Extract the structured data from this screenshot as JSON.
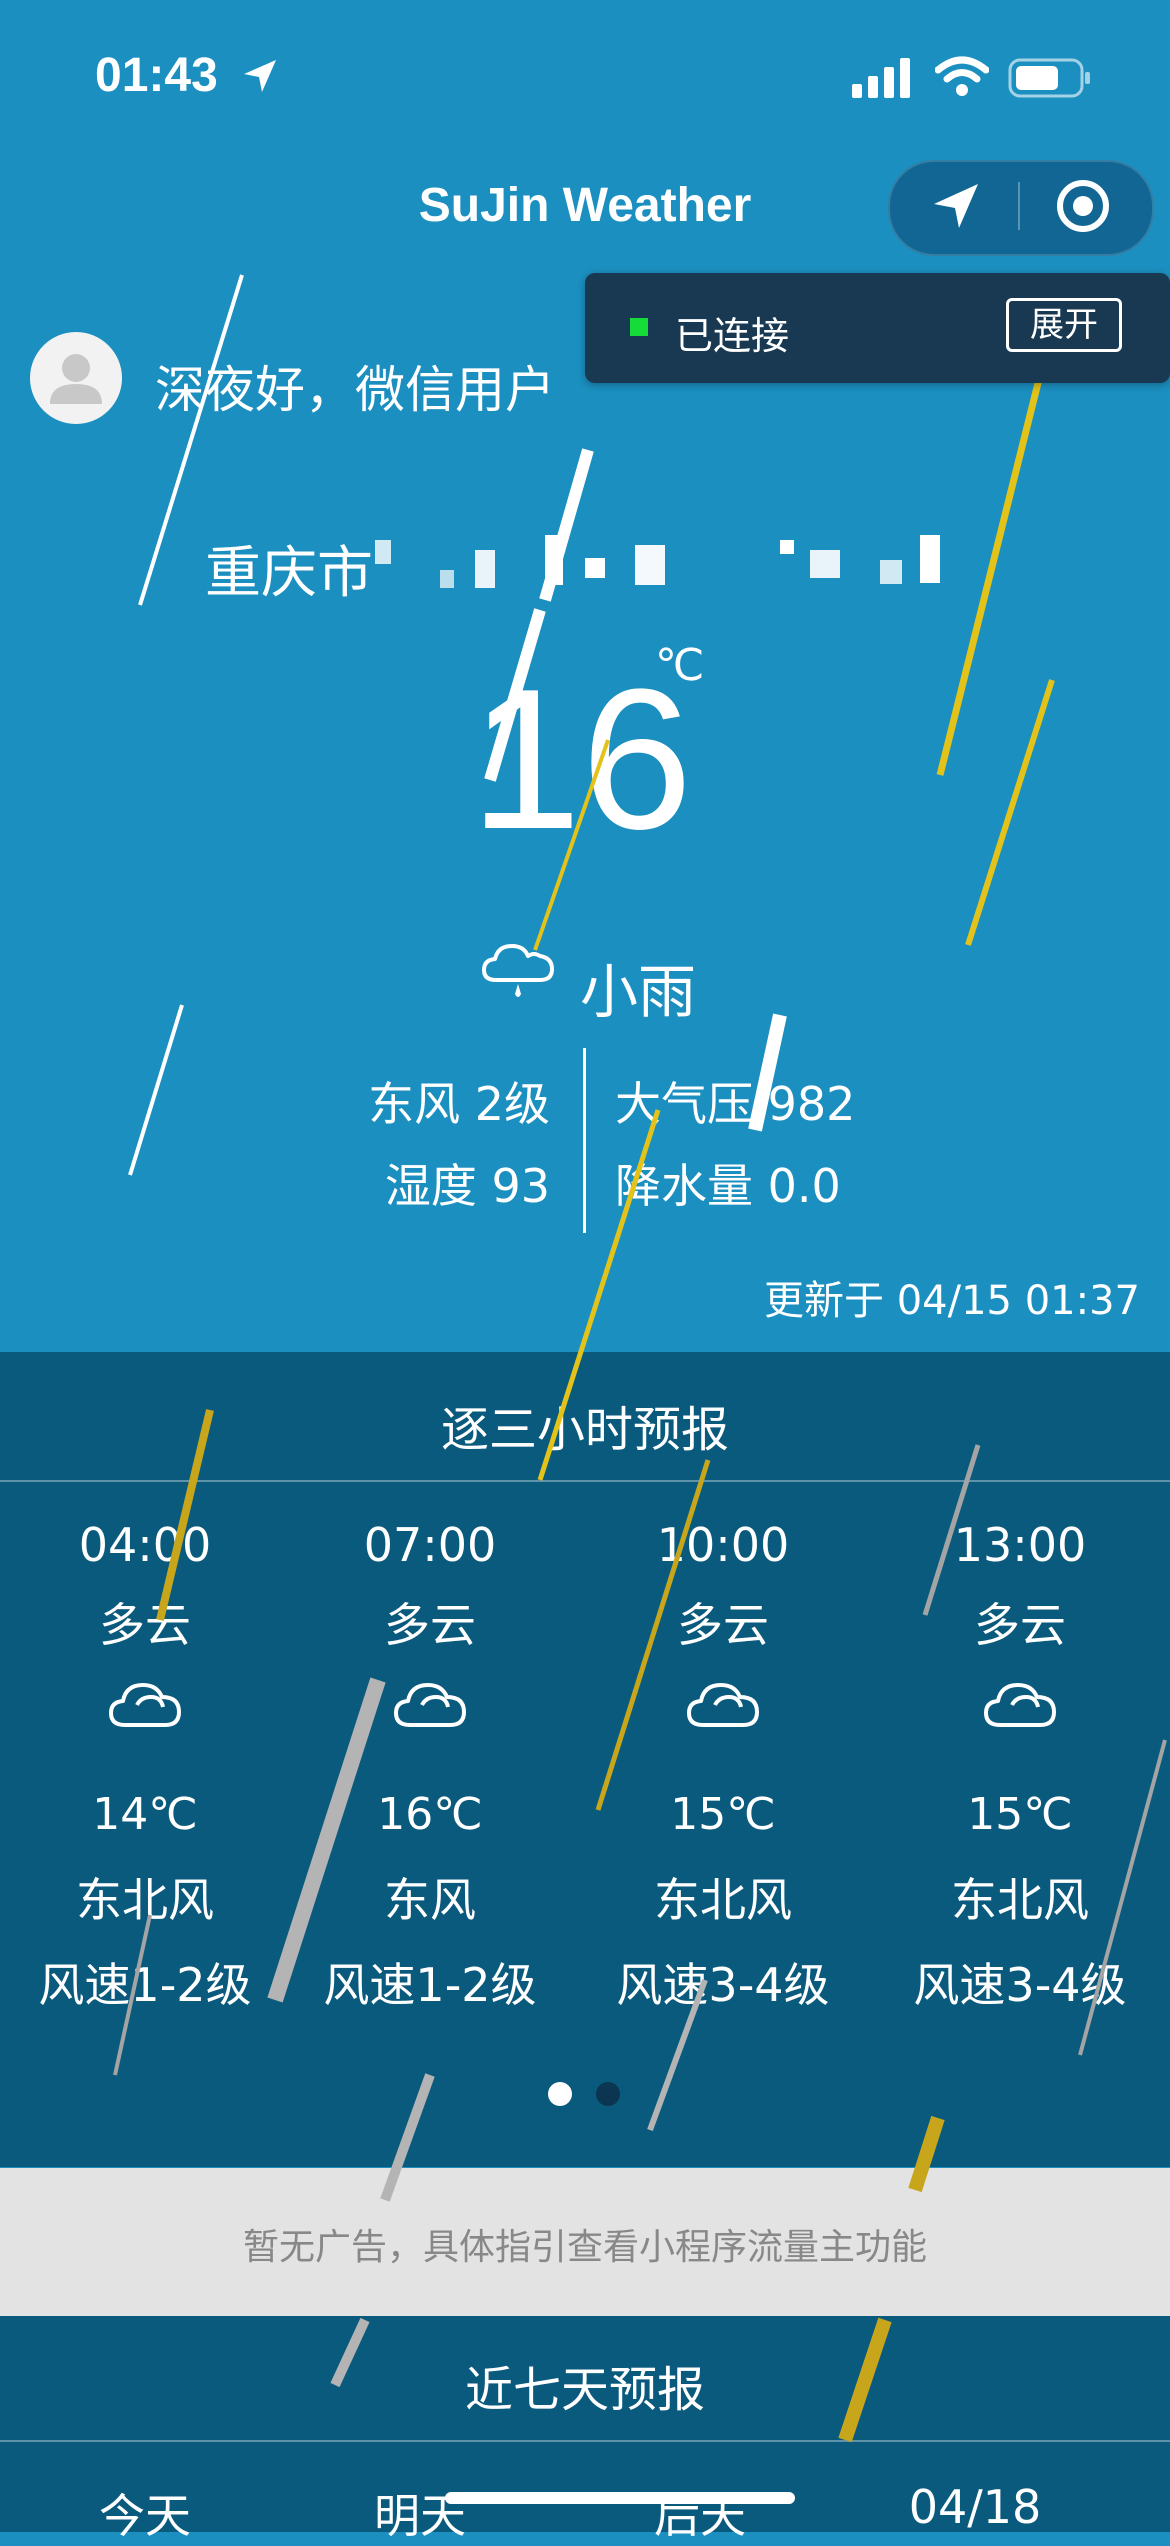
{
  "status_bar": {
    "time": "01:43",
    "icons": [
      "location-arrow-icon",
      "signal-icon",
      "wifi-icon",
      "battery-icon"
    ]
  },
  "header": {
    "title": "SuJin Weather",
    "capsule_buttons": [
      "navigation-arrow-icon",
      "target-icon"
    ]
  },
  "connection": {
    "status": "已连接",
    "status_color": "#16dc3a",
    "expand_label": "展开"
  },
  "greeting": {
    "text": "深夜好，微信用户",
    "avatar": "user-avatar-icon"
  },
  "location": {
    "city": "重庆市"
  },
  "current": {
    "temperature": "16",
    "unit": "℃",
    "condition_icon": "rain-cloud-icon",
    "condition": "小雨",
    "wind": "东风 2级",
    "humidity": "湿度 93",
    "pressure": "大气压 982",
    "precipitation": "降水量 0.0",
    "updated": "更新于 04/15 01:37"
  },
  "hourly": {
    "title": "逐三小时预报",
    "items": [
      {
        "time": "04:00",
        "cond": "多云",
        "icon": "cloud-icon",
        "temp": "14℃",
        "wind": "东北风",
        "speed": "风速1-2级"
      },
      {
        "time": "07:00",
        "cond": "多云",
        "icon": "cloud-icon",
        "temp": "16℃",
        "wind": "东风",
        "speed": "风速1-2级"
      },
      {
        "time": "10:00",
        "cond": "多云",
        "icon": "cloud-icon",
        "temp": "15℃",
        "wind": "东北风",
        "speed": "风速3-4级"
      },
      {
        "time": "13:00",
        "cond": "多云",
        "icon": "cloud-icon",
        "temp": "15℃",
        "wind": "东北风",
        "speed": "风速3-4级"
      }
    ],
    "page_count": 2,
    "active_page": 1
  },
  "ad": {
    "text": "暂无广告，具体指引查看小程序流量主功能"
  },
  "seven_day": {
    "title": "近七天预报",
    "days": [
      "今天",
      "明天",
      "后天",
      "04/18"
    ]
  },
  "colors": {
    "background": "#1b8fc0",
    "section": "#0a5a7d",
    "panel": "#193952",
    "rain_yellow": "#e3c21a",
    "rain_gray": "#b4b4b4"
  }
}
